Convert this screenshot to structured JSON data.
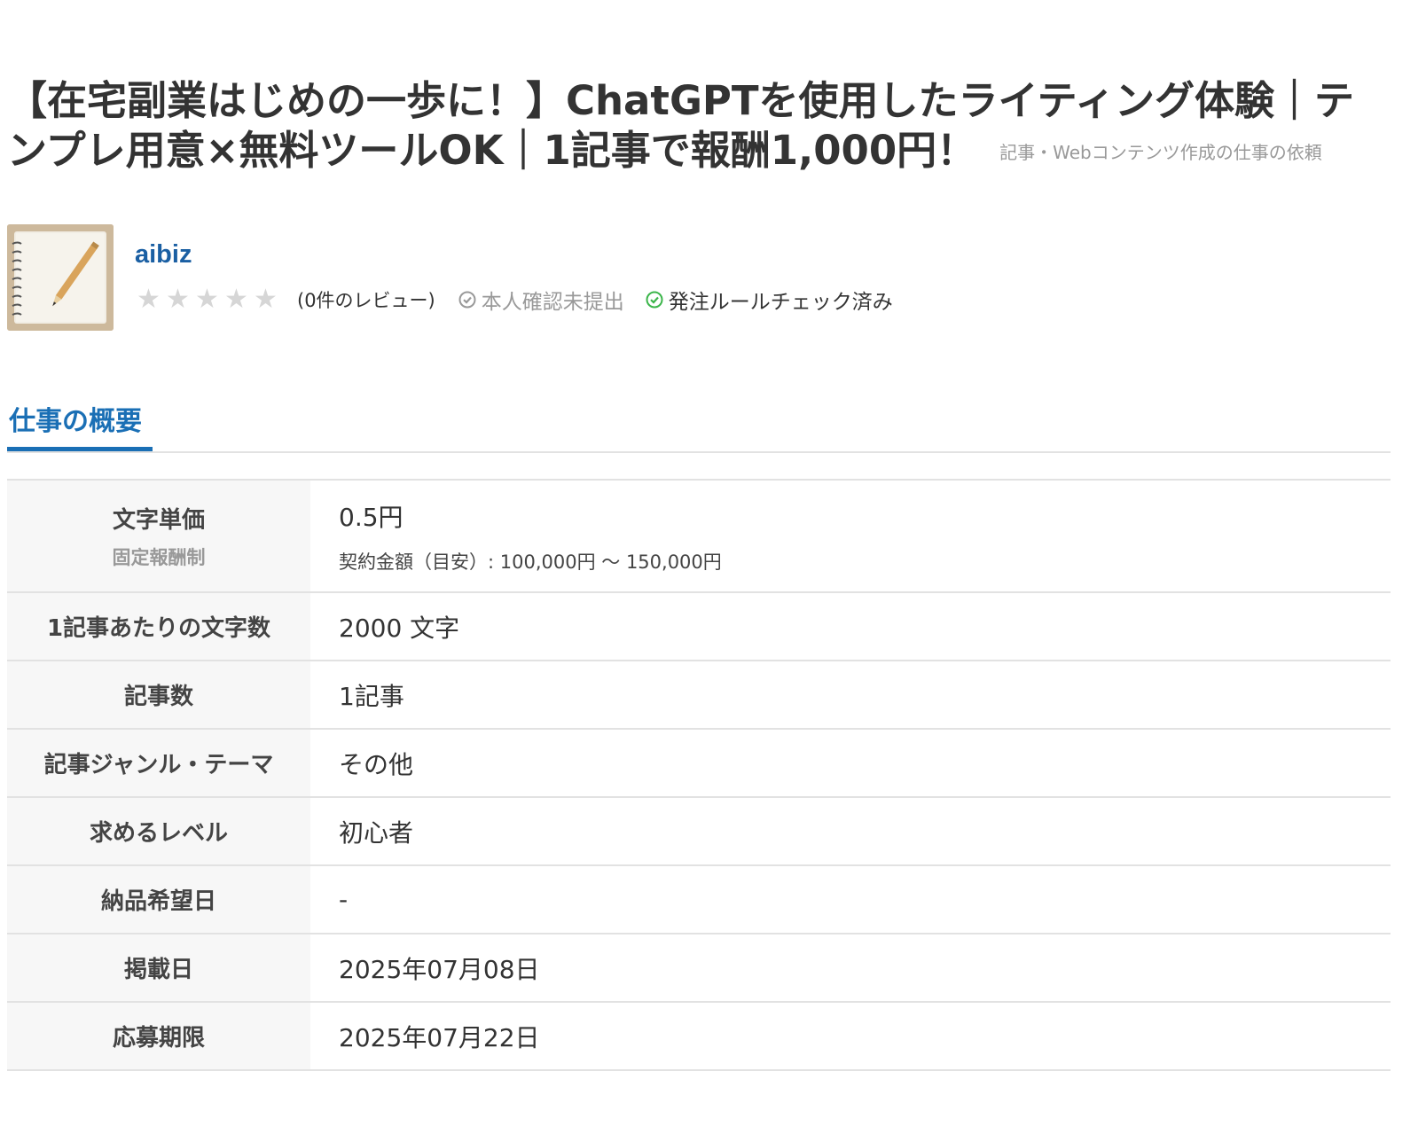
{
  "job": {
    "title": "【在宅副業はじめの一歩に！】ChatGPTを使用したライティング体験｜テンプレ用意×無料ツールOK｜1記事で報酬1,000円！",
    "category": "記事・Webコンテンツ作成の仕事の依頼"
  },
  "client": {
    "name": "aibiz",
    "avatar_icon": "notebook-pencil-photo",
    "rating_stars": 0,
    "review_count_text": "(0件のレビュー)",
    "identity_badge": "本人確認未提出",
    "rules_badge": "発注ルールチェック済み",
    "colors": {
      "name": "#1a5fa3",
      "unverified": "#999999",
      "check_green": "#3bb54a"
    }
  },
  "tabs": {
    "active_label": "仕事の概要",
    "accent": "#1a6fb5"
  },
  "summary": {
    "rows": [
      {
        "label": "文字単価",
        "label_sub": "固定報酬制",
        "value": "0.5円",
        "value_sub": "契約金額（目安）: 100,000円 〜 150,000円"
      },
      {
        "label": "1記事あたりの文字数",
        "value": "2000 文字"
      },
      {
        "label": "記事数",
        "value": "1記事"
      },
      {
        "label": "記事ジャンル・テーマ",
        "value": "その他"
      },
      {
        "label": "求めるレベル",
        "value": "初心者"
      },
      {
        "label": "納品希望日",
        "value": "-"
      },
      {
        "label": "掲載日",
        "value": "2025年07月08日"
      },
      {
        "label": "応募期限",
        "value": "2025年07月22日"
      }
    ]
  }
}
